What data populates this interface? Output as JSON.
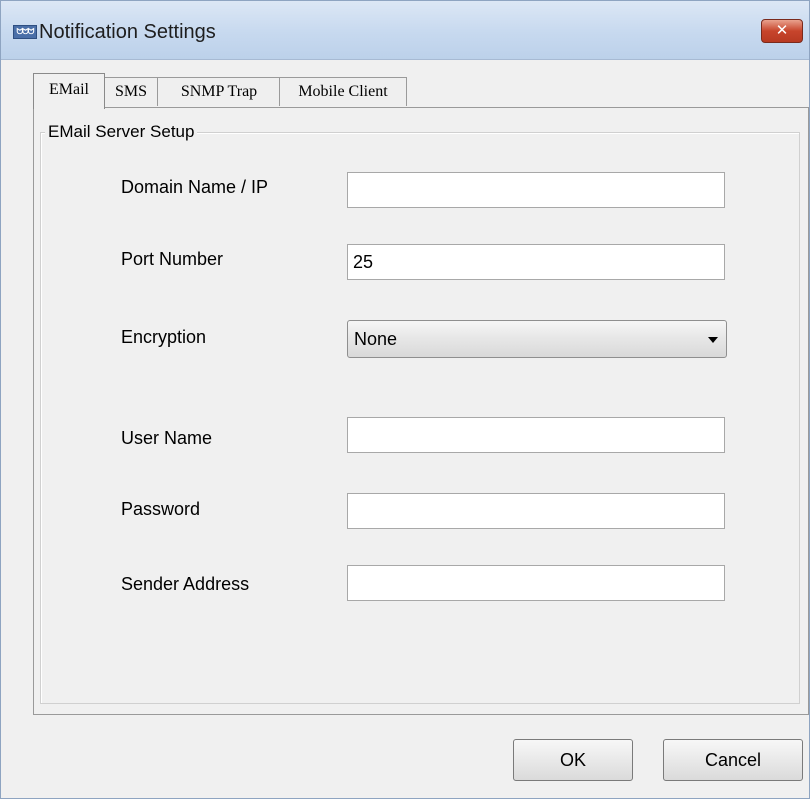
{
  "window": {
    "title": "Notification Settings",
    "app_icon_text": "ᗢᗢᗢ",
    "close_symbol": "✕"
  },
  "tabs": [
    {
      "label": "EMail",
      "active": true
    },
    {
      "label": "SMS",
      "active": false
    },
    {
      "label": "SNMP Trap",
      "active": false
    },
    {
      "label": "Mobile Client",
      "active": false
    }
  ],
  "email": {
    "group_title": "EMail Server Setup",
    "fields": {
      "domain": {
        "label": "Domain Name / IP",
        "value": ""
      },
      "port": {
        "label": "Port Number",
        "value": "25"
      },
      "encryption": {
        "label": "Encryption",
        "value": "None"
      },
      "user_name": {
        "label": "User Name",
        "value": ""
      },
      "password": {
        "label": "Password",
        "value": ""
      },
      "sender": {
        "label": "Sender Address",
        "value": ""
      }
    }
  },
  "buttons": {
    "ok": "OK",
    "cancel": "Cancel"
  },
  "colors": {
    "titlebar": "#c7d9ef",
    "close_button": "#c7452c",
    "dialog_background": "#f0f0f0"
  }
}
